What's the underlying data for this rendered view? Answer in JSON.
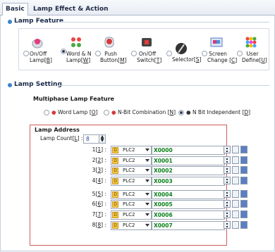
{
  "tabs": [
    {
      "label": "Basic",
      "active": true
    },
    {
      "label": "Lamp",
      "active": false
    },
    {
      "label": "Effect & Action",
      "active": false
    }
  ],
  "lamp_feature": {
    "title": "Lamp Feature",
    "options": [
      {
        "label_line1": "On/Off",
        "label_line2": "Lamp",
        "hotkey": "B",
        "selected": false,
        "icon": "on-off-lamp-icon"
      },
      {
        "label_line1": "Word & N",
        "label_line2": "Lamp",
        "hotkey": "W",
        "selected": true,
        "icon": "word-lamp-icon"
      },
      {
        "label_line1": "Push",
        "label_line2": "Button",
        "hotkey": "M",
        "selected": false,
        "icon": "push-button-icon"
      },
      {
        "label_line1": "On/Off",
        "label_line2": "Switch",
        "hotkey": "T",
        "selected": false,
        "icon": "switch-icon"
      },
      {
        "label_line1": "Selector",
        "label_line2": "",
        "hotkey": "S",
        "selected": false,
        "icon": "selector-icon"
      },
      {
        "label_line1": "Screen",
        "label_line2": "Change",
        "hotkey": "C",
        "selected": false,
        "icon": "screen-change-icon"
      },
      {
        "label_line1": "User",
        "label_line2": "Define",
        "hotkey": "U",
        "selected": false,
        "icon": "user-define-icon"
      }
    ]
  },
  "lamp_setting": {
    "title": "Lamp Setting",
    "multiphase_title": "Multiphase Lamp Feature",
    "multiphase_options": [
      {
        "label": "Word Lamp",
        "hotkey": "O",
        "selected": false
      },
      {
        "label": "N-Bit Combination",
        "hotkey": "N",
        "selected": false
      },
      {
        "label": "N Bit Independent",
        "hotkey": "D",
        "selected": true
      }
    ],
    "lamp_address": {
      "title": "Lamp Address",
      "count_label": "Lamp Count",
      "count_hotkey": "L",
      "count_value": "8",
      "rows": [
        {
          "num": "1",
          "hotkey": "1",
          "device": "PLC2",
          "address": "X0000"
        },
        {
          "num": "2",
          "hotkey": "2",
          "device": "PLC2",
          "address": "X0001"
        },
        {
          "num": "3",
          "hotkey": "3",
          "device": "PLC2",
          "address": "X0002"
        },
        {
          "num": "4",
          "hotkey": "4",
          "device": "PLC2",
          "address": "X0003"
        },
        {
          "num": "5",
          "hotkey": "5",
          "device": "PLC2",
          "address": "X0004"
        },
        {
          "num": "6",
          "hotkey": "6",
          "device": "PLC2",
          "address": "X0005"
        },
        {
          "num": "7",
          "hotkey": "7",
          "device": "PLC2",
          "address": "X0006"
        },
        {
          "num": "8",
          "hotkey": "8",
          "device": "PLC2",
          "address": "X0007"
        }
      ]
    }
  },
  "colors": {
    "address_text": "#0a7f1a",
    "address_box_border": "#d15a5a",
    "section_bullet": "#3a84cf"
  }
}
